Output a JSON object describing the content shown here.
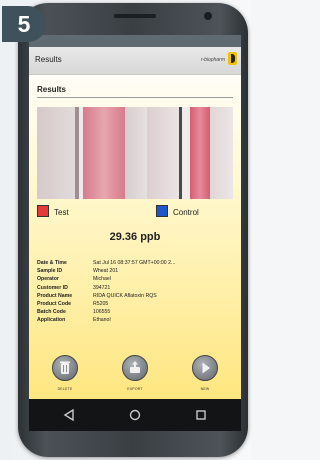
{
  "step_badge": "5",
  "app": {
    "title": "Results",
    "brand": "r-biopharm"
  },
  "section": {
    "title": "Results"
  },
  "legend": {
    "test_label": "Test",
    "control_label": "Control",
    "test_color": "#e43a3a",
    "control_color": "#1f57c8"
  },
  "result": "29.36 ppb",
  "details": [
    {
      "label": "Date & Time",
      "value": "Sat Jul 16 08:37:57 GMT+00:00 2..."
    },
    {
      "label": "Sample ID",
      "value": "Wheat 201"
    },
    {
      "label": "Operator",
      "value": "Michael"
    },
    {
      "label": "Customer ID",
      "value": "394721"
    },
    {
      "label": "Product Name",
      "value": "RIDA QUICK Aflatoxin RQS"
    },
    {
      "label": "Product Code",
      "value": "R5205"
    },
    {
      "label": "Batch Code",
      "value": "106555"
    },
    {
      "label": "Application",
      "value": "Ethanol"
    }
  ],
  "actions": {
    "delete": "DELETE",
    "export": "EXPORT",
    "new": "NEW"
  },
  "navbar": {
    "back_icon": "back-triangle-icon",
    "home_icon": "home-circle-icon",
    "recents_icon": "recents-square-icon"
  }
}
